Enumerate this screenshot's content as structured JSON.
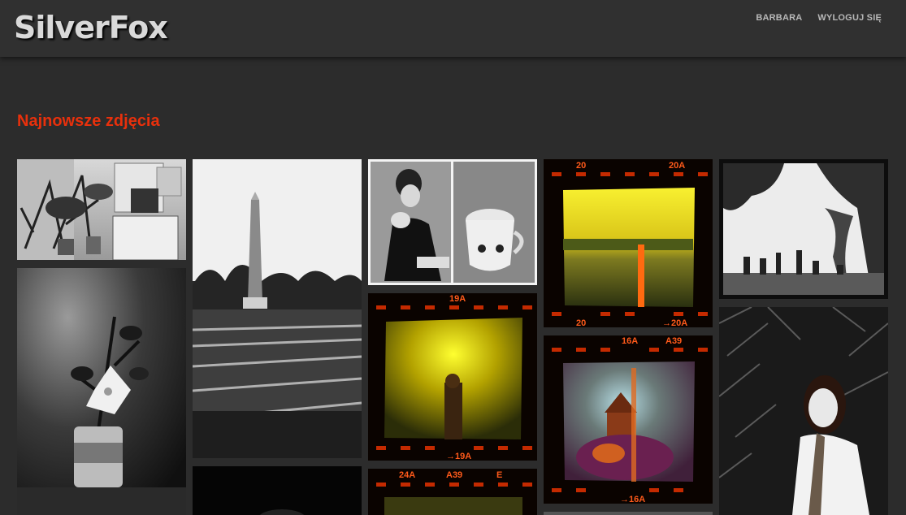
{
  "header": {
    "logo": "SilverFox",
    "nav": [
      {
        "label": "BARBARA"
      },
      {
        "label": "WYLOGUJ SIĘ"
      }
    ]
  },
  "main": {
    "title": "Najnowsze zdjęcia"
  },
  "film_frames": {
    "frame_20": "20",
    "frame_20a": "20A",
    "frame_20_bottom": "20",
    "frame_20a_bottom": "→20A",
    "frame_19a": "19A",
    "frame_19a_bottom": "→19A",
    "frame_16a": "16A",
    "frame_a39": "A39",
    "frame_16a_bottom": "→16A",
    "frame_24a": "24A",
    "frame_a39b": "A39",
    "frame_e": "E"
  },
  "colors": {
    "accent": "#e8300c",
    "background": "#2c2c2c",
    "topbar": "#303030"
  }
}
